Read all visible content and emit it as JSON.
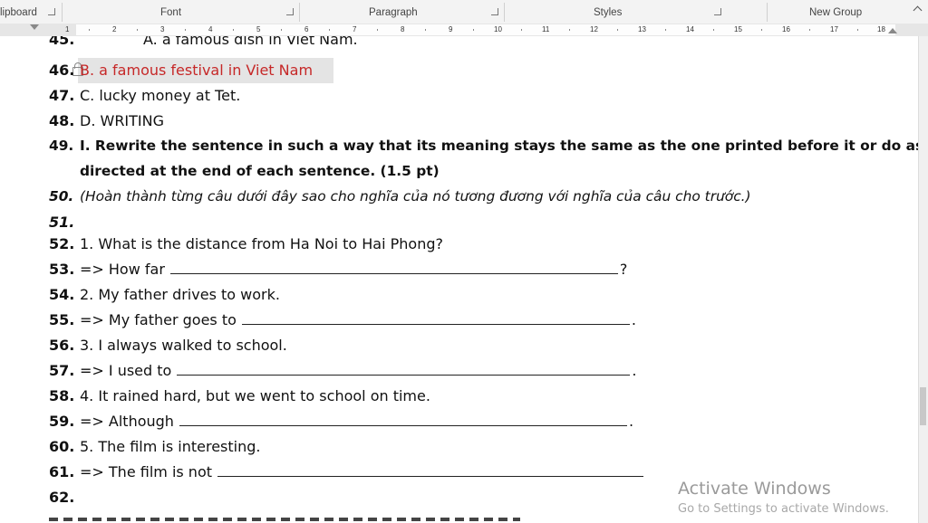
{
  "ribbon": {
    "groups": [
      "lipboard",
      "Font",
      "Paragraph",
      "Styles",
      "New Group"
    ]
  },
  "ruler": {
    "numbers": [
      "1",
      "2",
      "3",
      "4",
      "5",
      "6",
      "7",
      "8",
      "9",
      "10",
      "11",
      "12",
      "13",
      "14",
      "15",
      "16",
      "17",
      "18"
    ]
  },
  "document": {
    "lines": [
      {
        "num": "45.",
        "text": "A. a famous dish in Viet Nam."
      },
      {
        "num": "46.",
        "text": "B. a famous festival in Viet Nam"
      },
      {
        "num": "47.",
        "text": "C. lucky money at Tet."
      },
      {
        "num": "48.",
        "text": "D. WRITING"
      },
      {
        "num": "49.",
        "text": "I. Rewrite the sentence in such a way that its meaning stays the same as the one printed before it or do as"
      },
      {
        "num": "",
        "text": "directed at the end of each sentence. (1.5 pt)"
      },
      {
        "num": "50.",
        "text": "(Hoàn thành từng câu dưới đây sao cho nghĩa của nó tương đương với nghĩa của câu cho trước.)"
      },
      {
        "num": "51.",
        "text": ""
      },
      {
        "num": "52.",
        "text": "1. What is the distance from Ha Noi to Hai Phong?"
      },
      {
        "num": "53.",
        "text": "=> How far",
        "end": "?"
      },
      {
        "num": "54.",
        "text": "2. My father drives to work."
      },
      {
        "num": "55.",
        "text": "=> My father goes to",
        "end": "."
      },
      {
        "num": "56.",
        "text": "3. I always walked to school."
      },
      {
        "num": "57.",
        "text": "=> I used to",
        "end": "."
      },
      {
        "num": "58.",
        "text": "4. It rained hard, but we went to school on time."
      },
      {
        "num": "59.",
        "text": "=> Although",
        "end": "."
      },
      {
        "num": "60.",
        "text": "5. The film is interesting."
      },
      {
        "num": "61.",
        "text": "=> The film is not",
        "end": ""
      },
      {
        "num": "62.",
        "text": ""
      }
    ]
  },
  "watermark": {
    "title": "Activate Windows",
    "subtitle": "Go to Settings to activate Windows."
  },
  "colors": {
    "highlight_text": "#c62828",
    "highlight_bg": "#e4e4e4"
  }
}
